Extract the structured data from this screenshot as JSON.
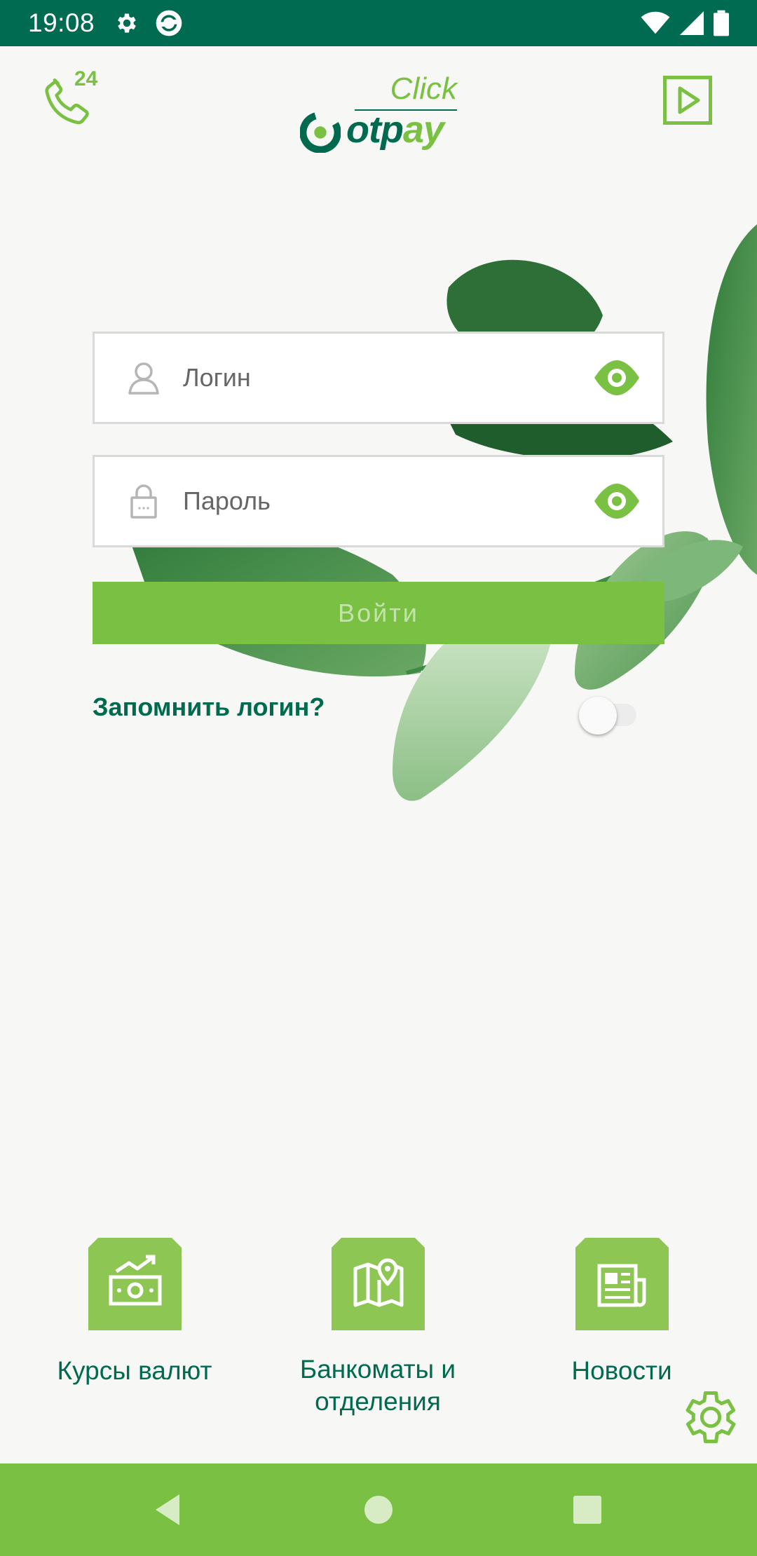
{
  "status_bar": {
    "time": "19:08",
    "left_icons": [
      "settings-icon",
      "sync-icon"
    ],
    "right_icons": [
      "wifi-icon",
      "signal-icon",
      "battery-icon"
    ]
  },
  "header": {
    "hotline_badge": "24",
    "logo": {
      "top_word": "Click",
      "brand": "otpay"
    },
    "icons": {
      "left": "phone-24-icon",
      "right": "video-play-icon"
    }
  },
  "login_form": {
    "login_placeholder": "Логин",
    "password_placeholder": "Пароль",
    "login_value": "",
    "password_value": "",
    "submit_label": "Войти",
    "remember_label": "Запомнить логин?",
    "remember_enabled": false
  },
  "quick_links": [
    {
      "label": "Курсы валют",
      "icon": "currency-rates-icon"
    },
    {
      "label": "Банкоматы и отделения",
      "icon": "map-pin-icon"
    },
    {
      "label": "Новости",
      "icon": "newspaper-icon"
    }
  ],
  "colors": {
    "brand_dark": "#006b50",
    "brand_green": "#7ac143",
    "tile_green": "#8dc653",
    "background": "#f7f7f5"
  }
}
